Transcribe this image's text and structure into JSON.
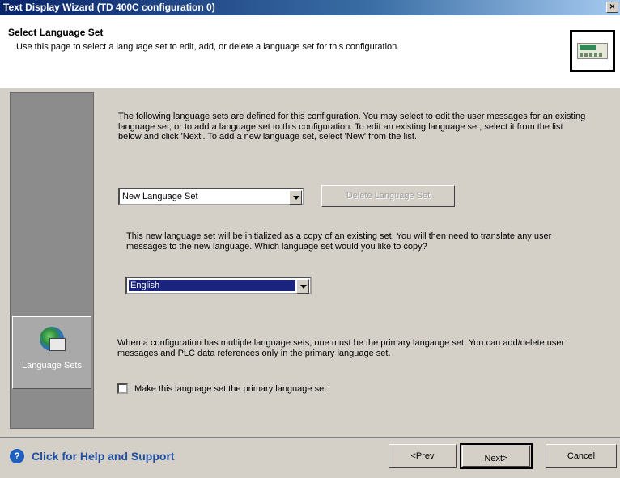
{
  "window": {
    "title": "Text Display Wizard (TD 400C configuration 0)",
    "close_glyph": "×"
  },
  "header": {
    "title": "Select Language Set",
    "subtitle": "Use this page to select a language set to edit, add, or delete a language set for this configuration.",
    "icon": "text-display-device-icon"
  },
  "sidebar": {
    "items": [
      {
        "label": "Language Sets",
        "icon": "globe-keyboard-icon",
        "selected": true
      }
    ]
  },
  "main": {
    "intro": "The following language sets are defined for this configuration. You may select to edit the user messages for an existing language set, or to add a language set to this configuration. To edit an existing language set, select it from the list below and click 'Next'. To add a new language set, select 'New' from the list.",
    "language_select": {
      "value": "New Language Set"
    },
    "delete_button": {
      "label": "Delete Language Set",
      "enabled": false
    },
    "copy_note": "This new language set will be initialized as a copy of an existing set. You will then need to translate any user messages to the new language. Which language set would you like to copy?",
    "copy_select": {
      "value": "English"
    },
    "primary_note": "When a configuration has multiple language sets, one must be the primary langauge set. You can add/delete user messages and PLC data references only in the primary language set.",
    "primary_checkbox": {
      "label": "Make this language set the primary language set.",
      "checked": false
    }
  },
  "footer": {
    "help_label": "Click for Help and Support",
    "help_icon": "question-circle-icon",
    "prev_label": "<Prev",
    "next_label": "Next>",
    "cancel_label": "Cancel"
  },
  "colors": {
    "title_bar": "#0a246a",
    "dialog_face": "#d4d0c8",
    "sidebar": "#8c8c8c",
    "selection": "#1a237e",
    "help_link": "#1f4fa0"
  }
}
